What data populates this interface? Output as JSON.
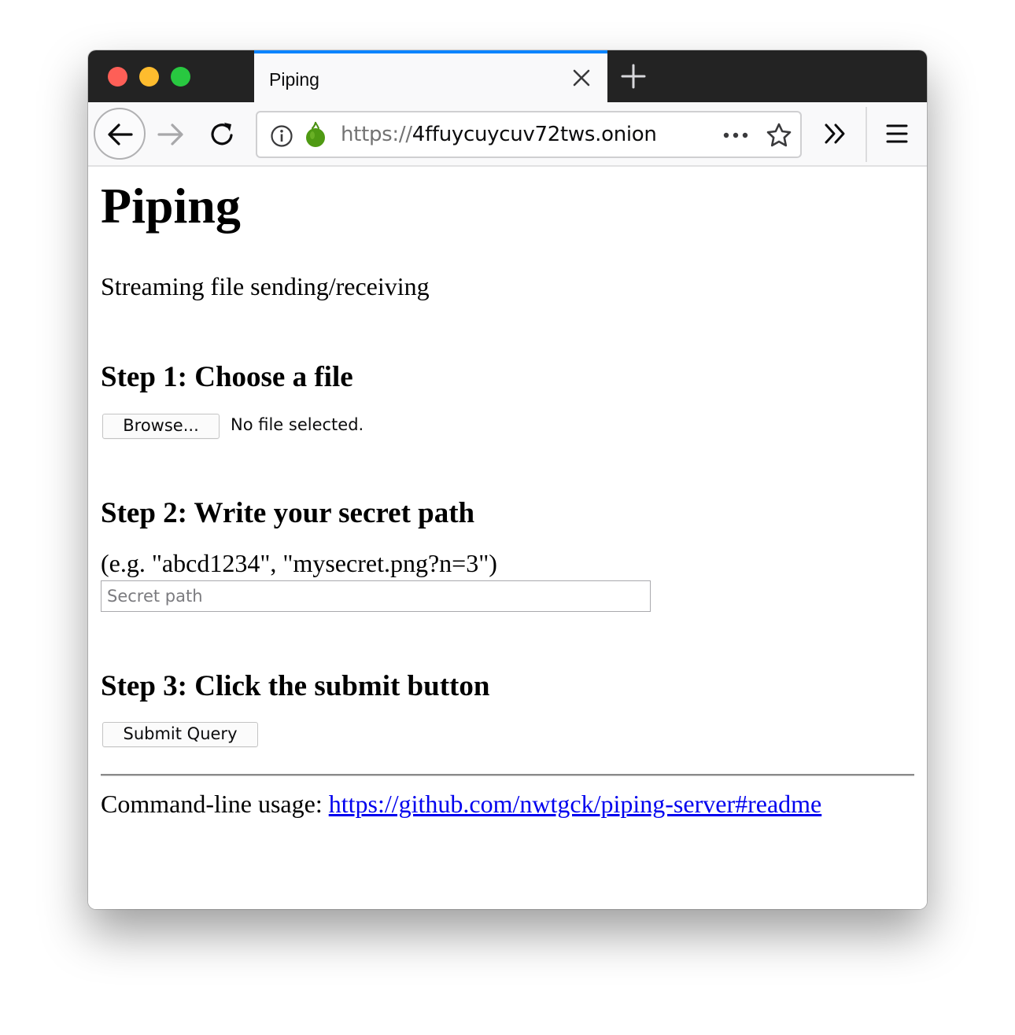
{
  "browser": {
    "tab": {
      "title": "Piping"
    },
    "url": {
      "scheme": "https://",
      "host": "4ffuycuycuv72tws.onion"
    },
    "accent_color": "#0a84ff",
    "icons": {
      "close_dot": "window-close-dot",
      "minimize_dot": "window-minimize-dot",
      "maximize_dot": "window-maximize-dot",
      "tab_close": "close-icon",
      "new_tab": "plus-icon",
      "back": "back-arrow-icon",
      "forward": "forward-arrow-icon",
      "reload": "reload-icon",
      "info": "info-icon",
      "onion": "onion-icon",
      "page_actions": "more-dots-icon",
      "bookmark": "star-icon",
      "overflow": "double-chevron-icon",
      "menu": "hamburger-menu-icon"
    }
  },
  "page": {
    "title": "Piping",
    "subtitle": "Streaming file sending/receiving",
    "step1": {
      "heading": "Step 1: Choose a file",
      "browse_label": "Browse...",
      "file_status": "No file selected."
    },
    "step2": {
      "heading": "Step 2: Write your secret path",
      "hint": "(e.g. \"abcd1234\", \"mysecret.png?n=3\")",
      "input_value": "",
      "input_placeholder": "Secret path"
    },
    "step3": {
      "heading": "Step 3: Click the submit button",
      "submit_label": "Submit Query"
    },
    "footer": {
      "label": "Command-line usage: ",
      "link_text": "https://github.com/nwtgck/piping-server#readme"
    },
    "link_color": "#0000ee"
  }
}
